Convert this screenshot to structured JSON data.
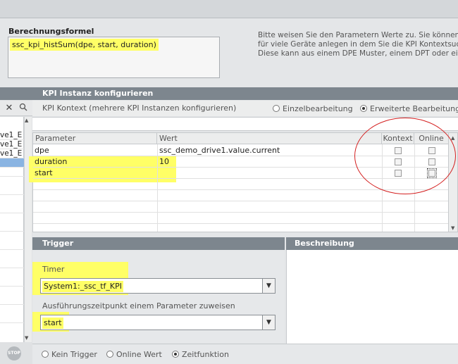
{
  "formula": {
    "title": "Berechnungsformel",
    "expression": "ssc_kpi_histSum(dpe, start, duration)"
  },
  "info": {
    "lines": [
      "Bitte weisen Sie den Parametern Werte zu. Sie können P",
      "für viele Geräte anlegen in dem Sie die KPI Kontextsuche",
      "Diese kann aus einem DPE Muster, einem DPT oder ein"
    ]
  },
  "left_list": {
    "items": [
      "ve1_E",
      "ve1_E",
      "ve1_E"
    ],
    "selected_index": 3
  },
  "kpi": {
    "header": "KPI Instanz konfigurieren",
    "context_label": "KPI Kontext (mehrere KPI Instanzen konfigurieren)",
    "mode_single": "Einzelbearbeitung",
    "mode_extended": "Erweiterte Bearbeitung",
    "selected_mode": "Erweiterte Bearbeitung"
  },
  "param_table": {
    "columns": [
      "Parameter",
      "Wert",
      "Kontext",
      "Online"
    ],
    "rows": [
      {
        "parameter": "dpe",
        "wert": "ssc_demo_drive1.value.current",
        "kontext": false,
        "online": false
      },
      {
        "parameter": "duration",
        "wert": "10",
        "kontext": false,
        "online": false
      },
      {
        "parameter": "start",
        "wert": "",
        "kontext": false,
        "online": false
      }
    ]
  },
  "trigger": {
    "header": "Trigger",
    "timer_label": "Timer",
    "timer_value": "System1:_ssc_tf_KPI",
    "assign_label": "Ausführungszeitpunkt einem Parameter zuweisen",
    "assign_value": "start",
    "options": [
      "Kein Trigger",
      "Online Wert",
      "Zeitfunktion"
    ],
    "selected_option": "Zeitfunktion"
  },
  "description": {
    "header": "Beschreibung"
  },
  "stop_button": {
    "label": "STOP"
  },
  "colors": {
    "highlight": "#ffff66",
    "header_bg": "#7d868e",
    "annotation_circle": "#d42020",
    "selection": "#8ab4e2"
  }
}
